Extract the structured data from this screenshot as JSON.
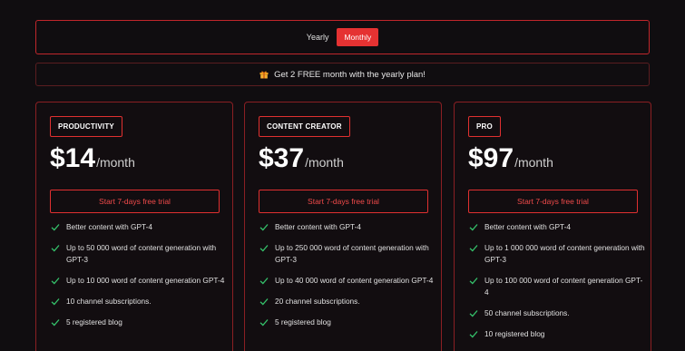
{
  "billing_toggle": {
    "yearly_label": "Yearly",
    "monthly_label": "Monthly",
    "selected": "Monthly"
  },
  "promo": {
    "icon": "gift-icon",
    "text": "Get 2 FREE month with the yearly plan!"
  },
  "colors": {
    "accent": "#e53232",
    "border": "#8a1f23",
    "background": "#100d10",
    "check": "#35c26b"
  },
  "plans": [
    {
      "name": "PRODUCTIVITY",
      "price": "$14",
      "period": "/month",
      "cta": "Start 7-days free trial",
      "features": [
        "Better content with GPT-4",
        "Up to 50 000 word of content generation with GPT-3",
        "Up to 10 000 word of content generation GPT-4",
        "10 channel subscriptions.",
        "5 registered blog"
      ]
    },
    {
      "name": "CONTENT CREATOR",
      "price": "$37",
      "period": "/month",
      "cta": "Start 7-days free trial",
      "features": [
        "Better content with GPT-4",
        "Up to 250 000 word of content generation with GPT-3",
        "Up to 40 000 word of content generation GPT-4",
        "20 channel subscriptions.",
        "5 registered blog"
      ]
    },
    {
      "name": "PRO",
      "price": "$97",
      "period": "/month",
      "cta": "Start 7-days free trial",
      "features": [
        "Better content with GPT-4",
        "Up to 1 000 000 word of content generation with GPT-3",
        "Up to 100 000 word of content generation GPT-4",
        "50 channel subscriptions.",
        "10 registered blog"
      ]
    }
  ]
}
